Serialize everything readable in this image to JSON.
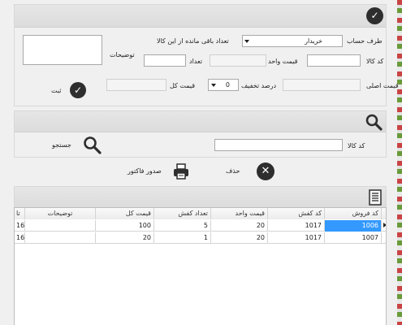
{
  "top_form": {
    "account_side_label": "طرف حساب",
    "account_side_value": "خریدار",
    "remaining_label": "تعداد باقی مانده از این کالا",
    "notes_label": "توضیحات",
    "product_code_label": "کد کالا",
    "unit_price_label": "قیمت واحد",
    "quantity_label": "تعداد",
    "original_price_label": "قیمت اصلی",
    "discount_label": "درصد تخفیف",
    "discount_value": "0",
    "total_price_label": "قیمت کل",
    "register_label": "ثبت"
  },
  "search_panel": {
    "product_code_label": "کد کالا",
    "search_label": "جستجو"
  },
  "actions": {
    "print_invoice_label": "صدور فاکتور",
    "delete_label": "حذف"
  },
  "table": {
    "columns": [
      "کد فروش",
      "کد کفش",
      "قیمت واحد",
      "تعداد کفش",
      "قیمت کل",
      "توضیحات",
      "تا"
    ],
    "rows": [
      {
        "sale_code": "1006",
        "shoe_code": "1017",
        "unit_price": "20",
        "shoe_count": "5",
        "total": "100",
        "notes": "",
        "extra": "16"
      },
      {
        "sale_code": "1007",
        "shoe_code": "1017",
        "unit_price": "20",
        "shoe_count": "1",
        "total": "20",
        "notes": "",
        "extra": "16"
      }
    ]
  },
  "colors": {
    "selection": "#3399ff",
    "icon_dark": "#2e2e2e"
  }
}
